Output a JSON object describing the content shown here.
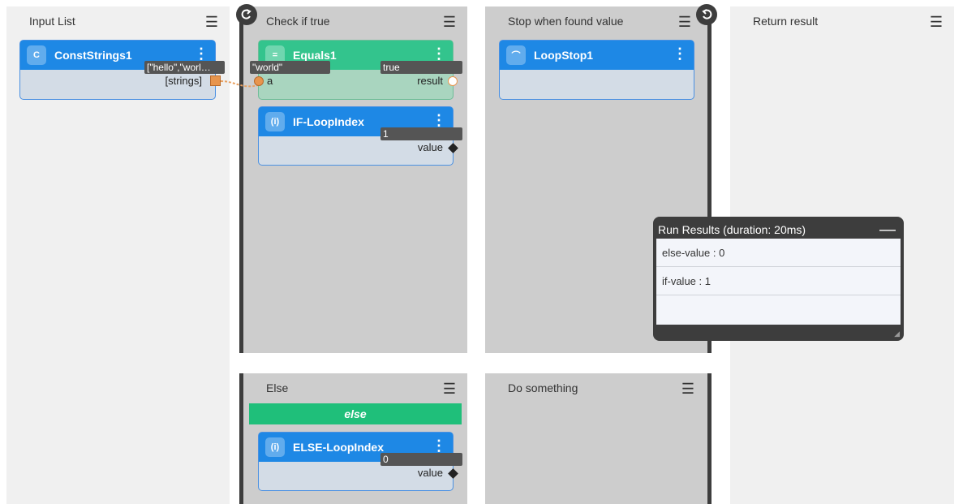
{
  "lanes": {
    "input_list": {
      "title": "Input List"
    },
    "check_if_true": {
      "title": "Check if true"
    },
    "stop_when_found": {
      "title": "Stop when found value"
    },
    "return_result": {
      "title": "Return result"
    },
    "else": {
      "title": "Else",
      "strip_label": "else"
    },
    "do_something": {
      "title": "Do something"
    }
  },
  "nodes": {
    "const_strings": {
      "icon": "C",
      "title": "ConstStrings1",
      "output_value": "[\"hello\",\"worl…",
      "output_port": "[strings]"
    },
    "equals": {
      "icon": "=",
      "title": "Equals1",
      "input_value": "\"world\"",
      "input_port": "a",
      "output_value": "true",
      "output_port": "result"
    },
    "if_loop_index": {
      "icon": "(i)",
      "title": "IF-LoopIndex",
      "output_value": "1",
      "output_port": "value"
    },
    "loop_stop": {
      "icon": "⌒",
      "title": "LoopStop1"
    },
    "else_loop_index": {
      "icon": "(i)",
      "title": "ELSE-LoopIndex",
      "output_value": "0",
      "output_port": "value"
    }
  },
  "run_results": {
    "title": "Run Results (duration: 20ms)",
    "rows": [
      "else-value : 0",
      "if-value : 1"
    ]
  },
  "icons": {
    "lane_menu": "menu-icon",
    "node_menu": "more-vertical-icon",
    "loop_start": "loop-start-icon",
    "loop_end": "loop-end-icon"
  },
  "colors": {
    "node_header": "#1e88e5",
    "equals_header": "#33c48d",
    "else_strip": "#1fbf7a",
    "lane_gray": "#cdcdcd",
    "panel": "#3d3d3d"
  }
}
